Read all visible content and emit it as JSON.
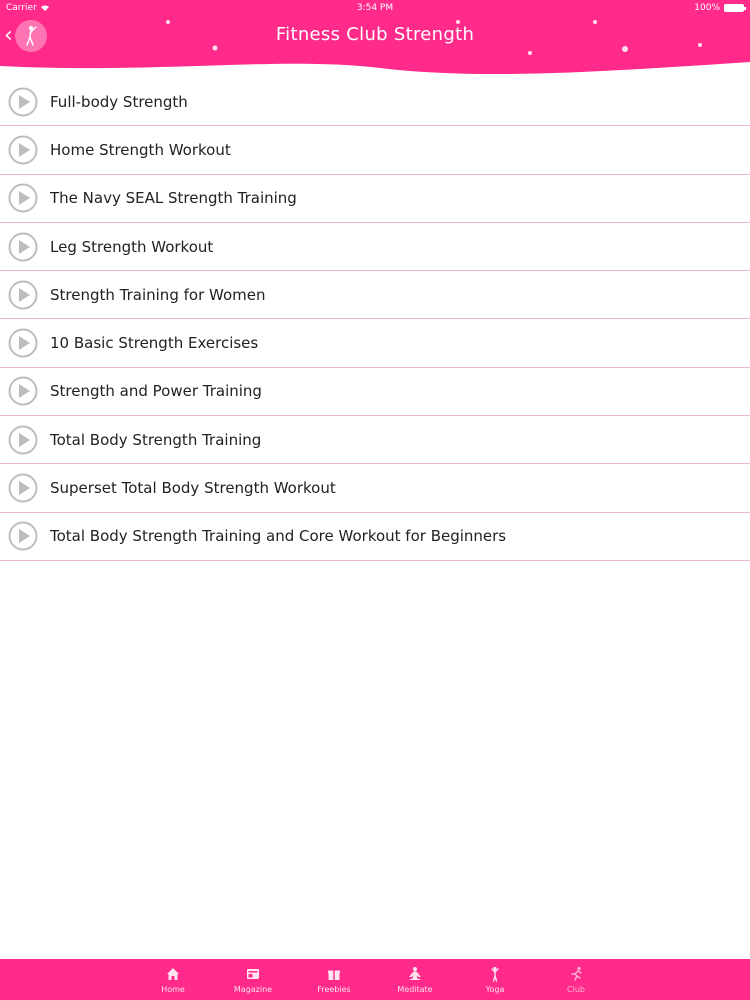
{
  "status_bar": {
    "carrier": "Carrier",
    "time": "3:54 PM",
    "battery": "100%"
  },
  "header": {
    "title": "Fitness Club Strength",
    "back_icon": "chevron-left-icon",
    "avatar_icon": "yoga-figure-icon",
    "color": "#ff2a8a"
  },
  "workouts": [
    {
      "label": "Full-body Strength"
    },
    {
      "label": "Home Strength Workout"
    },
    {
      "label": "The Navy SEAL Strength Training"
    },
    {
      "label": "Leg Strength Workout"
    },
    {
      "label": "Strength Training for Women"
    },
    {
      "label": "10 Basic Strength Exercises"
    },
    {
      "label": "Strength and Power Training"
    },
    {
      "label": "Total Body Strength Training"
    },
    {
      "label": "Superset Total Body Strength Workout"
    },
    {
      "label": "Total Body Strength Training and Core Workout for Beginners"
    }
  ],
  "tabbar": {
    "tabs": [
      {
        "label": "Home",
        "icon": "home-icon"
      },
      {
        "label": "Magazine",
        "icon": "magazine-icon"
      },
      {
        "label": "Freebies",
        "icon": "gift-icon"
      },
      {
        "label": "Meditate",
        "icon": "meditate-icon"
      },
      {
        "label": "Yoga",
        "icon": "yoga-icon"
      },
      {
        "label": "Club",
        "icon": "runner-icon"
      }
    ],
    "active": "Club"
  },
  "colors": {
    "accent": "#ff2a8a",
    "divider": "#f2b7cf",
    "play_icon": "#bdbdbd"
  }
}
